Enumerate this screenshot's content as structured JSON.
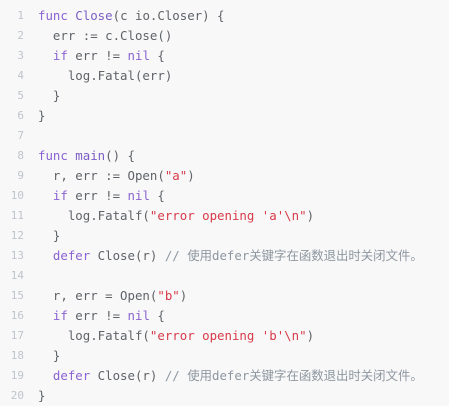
{
  "lines": [
    {
      "n": "1",
      "t": [
        {
          "k": "kw",
          "v": "func"
        },
        {
          "k": "plain",
          "v": " Close"
        },
        {
          "k": "plain",
          "v": "(c io.Closer) {"
        }
      ]
    },
    {
      "n": "2",
      "t": [
        {
          "k": "plain",
          "v": "  err := c.Close()"
        }
      ]
    },
    {
      "n": "3",
      "t": [
        {
          "k": "kw",
          "v": "  if"
        },
        {
          "k": "plain",
          "v": " err != "
        },
        {
          "k": "kw",
          "v": "nil"
        },
        {
          "k": "plain",
          "v": " {"
        }
      ]
    },
    {
      "n": "4",
      "t": [
        {
          "k": "plain",
          "v": "    log.Fatal(err)"
        }
      ]
    },
    {
      "n": "5",
      "t": [
        {
          "k": "plain",
          "v": "  }"
        }
      ]
    },
    {
      "n": "6",
      "t": [
        {
          "k": "plain",
          "v": "}"
        }
      ]
    },
    {
      "n": "7",
      "t": []
    },
    {
      "n": "8",
      "t": [
        {
          "k": "kw",
          "v": "func"
        },
        {
          "k": "fn",
          "v": " main"
        },
        {
          "k": "plain",
          "v": "() {"
        }
      ]
    },
    {
      "n": "9",
      "t": [
        {
          "k": "plain",
          "v": "  r, err := Open("
        },
        {
          "k": "str",
          "v": "\"a\""
        },
        {
          "k": "plain",
          "v": ")"
        }
      ]
    },
    {
      "n": "10",
      "t": [
        {
          "k": "kw",
          "v": "  if"
        },
        {
          "k": "plain",
          "v": " err != "
        },
        {
          "k": "kw",
          "v": "nil"
        },
        {
          "k": "plain",
          "v": " {"
        }
      ]
    },
    {
      "n": "11",
      "t": [
        {
          "k": "plain",
          "v": "    log.Fatalf("
        },
        {
          "k": "str",
          "v": "\"error opening 'a'\\n\""
        },
        {
          "k": "plain",
          "v": ")"
        }
      ]
    },
    {
      "n": "12",
      "t": [
        {
          "k": "plain",
          "v": "  }"
        }
      ]
    },
    {
      "n": "13",
      "t": [
        {
          "k": "kw",
          "v": "  defer"
        },
        {
          "k": "plain",
          "v": " Close(r)"
        },
        {
          "k": "cm",
          "v": " // 使用defer关键字在函数退出时关闭文件。"
        }
      ]
    },
    {
      "n": "14",
      "t": []
    },
    {
      "n": "15",
      "t": [
        {
          "k": "plain",
          "v": "  r, err = Open("
        },
        {
          "k": "str",
          "v": "\"b\""
        },
        {
          "k": "plain",
          "v": ")"
        }
      ]
    },
    {
      "n": "16",
      "t": [
        {
          "k": "kw",
          "v": "  if"
        },
        {
          "k": "plain",
          "v": " err != "
        },
        {
          "k": "kw",
          "v": "nil"
        },
        {
          "k": "plain",
          "v": " {"
        }
      ]
    },
    {
      "n": "17",
      "t": [
        {
          "k": "plain",
          "v": "    log.Fatalf("
        },
        {
          "k": "str",
          "v": "\"error opening 'b'\\n\""
        },
        {
          "k": "plain",
          "v": ")"
        }
      ]
    },
    {
      "n": "18",
      "t": [
        {
          "k": "plain",
          "v": "  }"
        }
      ]
    },
    {
      "n": "19",
      "t": [
        {
          "k": "kw",
          "v": "  defer"
        },
        {
          "k": "plain",
          "v": " Close(r)"
        },
        {
          "k": "cm",
          "v": " // 使用defer关键字在函数退出时关闭文件。"
        }
      ]
    },
    {
      "n": "20",
      "t": [
        {
          "k": "plain",
          "v": "}"
        }
      ]
    }
  ]
}
